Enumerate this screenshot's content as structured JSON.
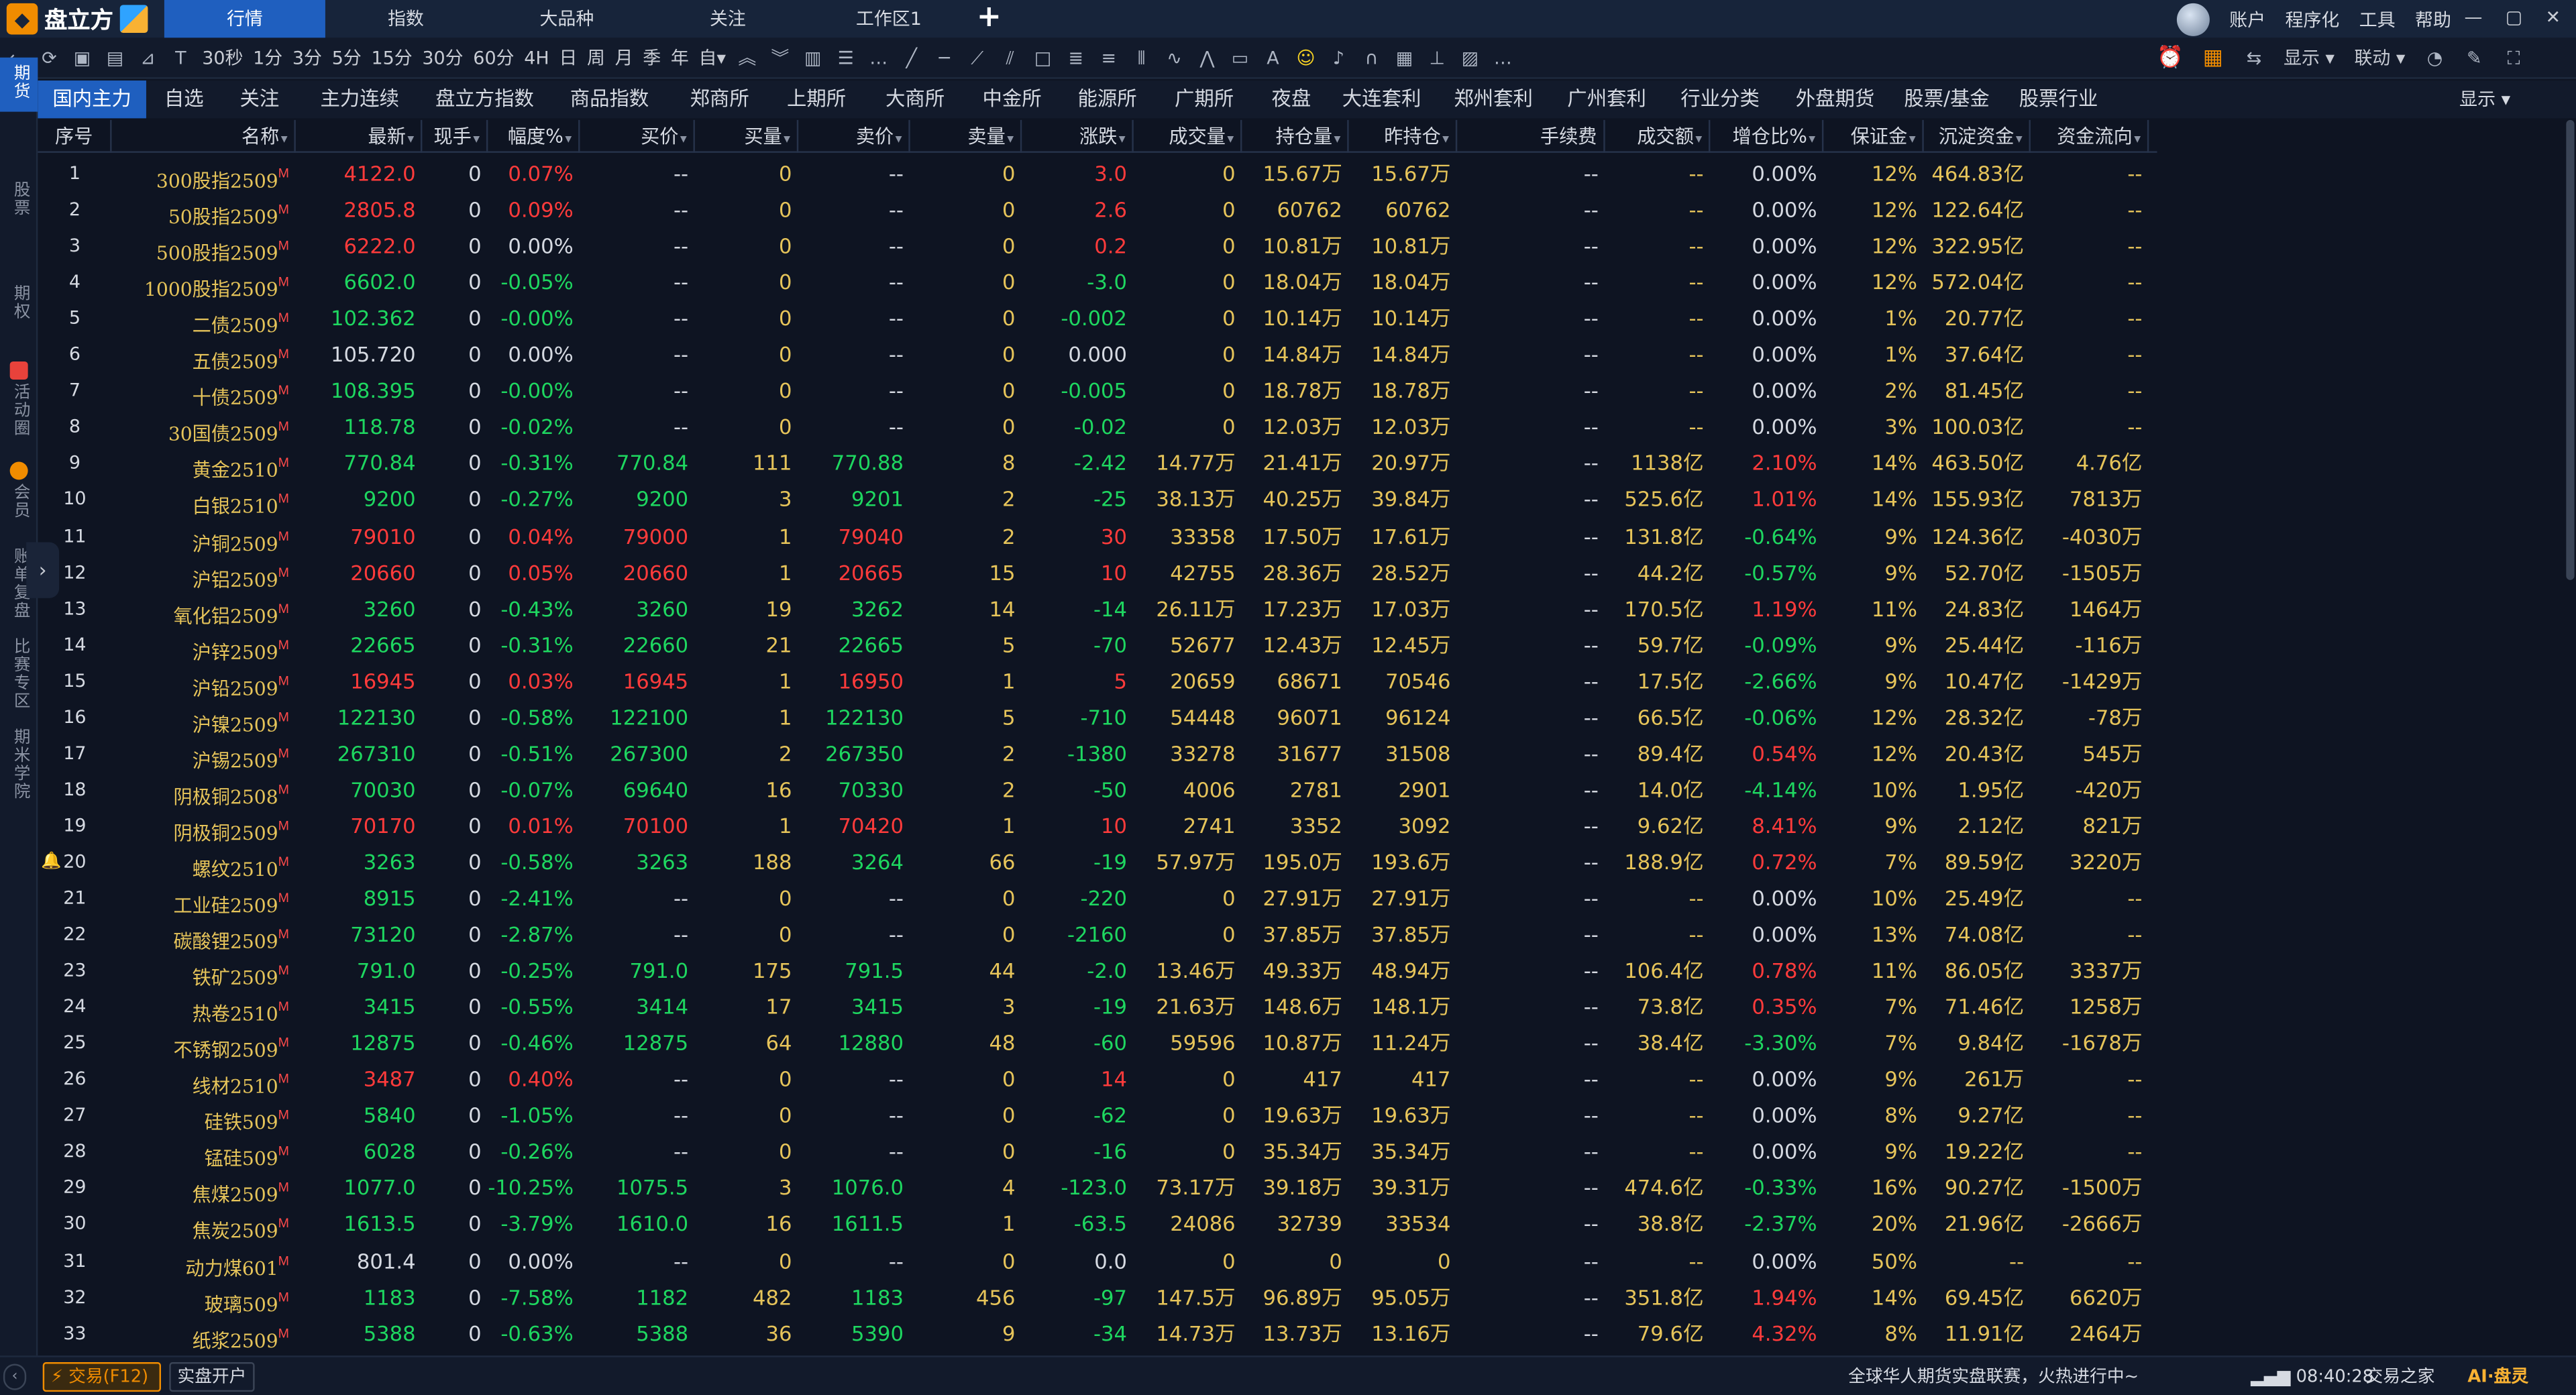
{
  "app": {
    "brand": "盘立方",
    "window_tabs": [
      "行情",
      "指数",
      "大品种",
      "关注",
      "工作区1"
    ],
    "menu": [
      "账户",
      "程序化",
      "工具",
      "帮助"
    ]
  },
  "toolbar": {
    "periods": [
      "30秒",
      "1分",
      "3分",
      "5分",
      "15分",
      "30分",
      "60分",
      "4H",
      "日",
      "周",
      "月",
      "季",
      "年",
      "自▾"
    ],
    "right": [
      "显示 ▾",
      "联动 ▾"
    ]
  },
  "left_nav": [
    "期货",
    "股票",
    "期权",
    "活动圈",
    "会员",
    "账单复盘",
    "比赛专区",
    "期米学院"
  ],
  "categories": [
    "国内主力",
    "自选",
    "关注",
    "主力连续",
    "盘立方指数",
    "商品指数",
    "郑商所",
    "上期所",
    "大商所",
    "中金所",
    "能源所",
    "广期所",
    "夜盘",
    "大连套利",
    "郑州套利",
    "广州套利",
    "行业分类",
    "外盘期货",
    "股票/基金",
    "股票行业"
  ],
  "category_show": "显示 ▾",
  "headers": [
    "序号",
    "名称",
    "最新",
    "现手",
    "幅度%",
    "买价",
    "买量",
    "卖价",
    "卖量",
    "涨跌",
    "成交量",
    "持仓量",
    "昨持仓",
    "手续费",
    "成交额",
    "增仓比%",
    "保证金",
    "沉淀资金",
    "资金流向"
  ],
  "rows": [
    [
      "1",
      "300股指2509",
      "4122.0",
      "0",
      "0.07%",
      "--",
      "0",
      "--",
      "0",
      "3.0",
      "0",
      "15.67万",
      "15.67万",
      "--",
      "--",
      "0.00%",
      "12%",
      "464.83亿",
      "--"
    ],
    [
      "2",
      "50股指2509",
      "2805.8",
      "0",
      "0.09%",
      "--",
      "0",
      "--",
      "0",
      "2.6",
      "0",
      "60762",
      "60762",
      "--",
      "--",
      "0.00%",
      "12%",
      "122.64亿",
      "--"
    ],
    [
      "3",
      "500股指2509",
      "6222.0",
      "0",
      "0.00%",
      "--",
      "0",
      "--",
      "0",
      "0.2",
      "0",
      "10.81万",
      "10.81万",
      "--",
      "--",
      "0.00%",
      "12%",
      "322.95亿",
      "--"
    ],
    [
      "4",
      "1000股指2509",
      "6602.0",
      "0",
      "-0.05%",
      "--",
      "0",
      "--",
      "0",
      "-3.0",
      "0",
      "18.04万",
      "18.04万",
      "--",
      "--",
      "0.00%",
      "12%",
      "572.04亿",
      "--"
    ],
    [
      "5",
      "二债2509",
      "102.362",
      "0",
      "-0.00%",
      "--",
      "0",
      "--",
      "0",
      "-0.002",
      "0",
      "10.14万",
      "10.14万",
      "--",
      "--",
      "0.00%",
      "1%",
      "20.77亿",
      "--"
    ],
    [
      "6",
      "五债2509",
      "105.720",
      "0",
      "0.00%",
      "--",
      "0",
      "--",
      "0",
      "0.000",
      "0",
      "14.84万",
      "14.84万",
      "--",
      "--",
      "0.00%",
      "1%",
      "37.64亿",
      "--"
    ],
    [
      "7",
      "十债2509",
      "108.395",
      "0",
      "-0.00%",
      "--",
      "0",
      "--",
      "0",
      "-0.005",
      "0",
      "18.78万",
      "18.78万",
      "--",
      "--",
      "0.00%",
      "2%",
      "81.45亿",
      "--"
    ],
    [
      "8",
      "30国债2509",
      "118.78",
      "0",
      "-0.02%",
      "--",
      "0",
      "--",
      "0",
      "-0.02",
      "0",
      "12.03万",
      "12.03万",
      "--",
      "--",
      "0.00%",
      "3%",
      "100.03亿",
      "--"
    ],
    [
      "9",
      "黄金2510",
      "770.84",
      "0",
      "-0.31%",
      "770.84",
      "111",
      "770.88",
      "8",
      "-2.42",
      "14.77万",
      "21.41万",
      "20.97万",
      "--",
      "1138亿",
      "2.10%",
      "14%",
      "463.50亿",
      "4.76亿"
    ],
    [
      "10",
      "白银2510",
      "9200",
      "0",
      "-0.27%",
      "9200",
      "3",
      "9201",
      "2",
      "-25",
      "38.13万",
      "40.25万",
      "39.84万",
      "--",
      "525.6亿",
      "1.01%",
      "14%",
      "155.93亿",
      "7813万"
    ],
    [
      "11",
      "沪铜2509",
      "79010",
      "0",
      "0.04%",
      "79000",
      "1",
      "79040",
      "2",
      "30",
      "33358",
      "17.50万",
      "17.61万",
      "--",
      "131.8亿",
      "-0.64%",
      "9%",
      "124.36亿",
      "-4030万"
    ],
    [
      "12",
      "沪铝2509",
      "20660",
      "0",
      "0.05%",
      "20660",
      "1",
      "20665",
      "15",
      "10",
      "42755",
      "28.36万",
      "28.52万",
      "--",
      "44.2亿",
      "-0.57%",
      "9%",
      "52.70亿",
      "-1505万"
    ],
    [
      "13",
      "氧化铝2509",
      "3260",
      "0",
      "-0.43%",
      "3260",
      "19",
      "3262",
      "14",
      "-14",
      "26.11万",
      "17.23万",
      "17.03万",
      "--",
      "170.5亿",
      "1.19%",
      "11%",
      "24.83亿",
      "1464万"
    ],
    [
      "14",
      "沪锌2509",
      "22665",
      "0",
      "-0.31%",
      "22660",
      "21",
      "22665",
      "5",
      "-70",
      "52677",
      "12.43万",
      "12.45万",
      "--",
      "59.7亿",
      "-0.09%",
      "9%",
      "25.44亿",
      "-116万"
    ],
    [
      "15",
      "沪铅2509",
      "16945",
      "0",
      "0.03%",
      "16945",
      "1",
      "16950",
      "1",
      "5",
      "20659",
      "68671",
      "70546",
      "--",
      "17.5亿",
      "-2.66%",
      "9%",
      "10.47亿",
      "-1429万"
    ],
    [
      "16",
      "沪镍2509",
      "122130",
      "0",
      "-0.58%",
      "122100",
      "1",
      "122130",
      "5",
      "-710",
      "54448",
      "96071",
      "96124",
      "--",
      "66.5亿",
      "-0.06%",
      "12%",
      "28.32亿",
      "-78万"
    ],
    [
      "17",
      "沪锡2509",
      "267310",
      "0",
      "-0.51%",
      "267300",
      "2",
      "267350",
      "2",
      "-1380",
      "33278",
      "31677",
      "31508",
      "--",
      "89.4亿",
      "0.54%",
      "12%",
      "20.43亿",
      "545万"
    ],
    [
      "18",
      "阴极铜2508",
      "70030",
      "0",
      "-0.07%",
      "69640",
      "16",
      "70330",
      "2",
      "-50",
      "4006",
      "2781",
      "2901",
      "--",
      "14.0亿",
      "-4.14%",
      "10%",
      "1.95亿",
      "-420万"
    ],
    [
      "19",
      "阴极铜2509",
      "70170",
      "0",
      "0.01%",
      "70100",
      "1",
      "70420",
      "1",
      "10",
      "2741",
      "3352",
      "3092",
      "--",
      "9.62亿",
      "8.41%",
      "9%",
      "2.12亿",
      "821万"
    ],
    [
      "20",
      "螺纹2510",
      "3263",
      "0",
      "-0.58%",
      "3263",
      "188",
      "3264",
      "66",
      "-19",
      "57.97万",
      "195.0万",
      "193.6万",
      "--",
      "188.9亿",
      "0.72%",
      "7%",
      "89.59亿",
      "3220万"
    ],
    [
      "21",
      "工业硅2509",
      "8915",
      "0",
      "-2.41%",
      "--",
      "0",
      "--",
      "0",
      "-220",
      "0",
      "27.91万",
      "27.91万",
      "--",
      "--",
      "0.00%",
      "10%",
      "25.49亿",
      "--"
    ],
    [
      "22",
      "碳酸锂2509",
      "73120",
      "0",
      "-2.87%",
      "--",
      "0",
      "--",
      "0",
      "-2160",
      "0",
      "37.85万",
      "37.85万",
      "--",
      "--",
      "0.00%",
      "13%",
      "74.08亿",
      "--"
    ],
    [
      "23",
      "铁矿2509",
      "791.0",
      "0",
      "-0.25%",
      "791.0",
      "175",
      "791.5",
      "44",
      "-2.0",
      "13.46万",
      "49.33万",
      "48.94万",
      "--",
      "106.4亿",
      "0.78%",
      "11%",
      "86.05亿",
      "3337万"
    ],
    [
      "24",
      "热卷2510",
      "3415",
      "0",
      "-0.55%",
      "3414",
      "17",
      "3415",
      "3",
      "-19",
      "21.63万",
      "148.6万",
      "148.1万",
      "--",
      "73.8亿",
      "0.35%",
      "7%",
      "71.46亿",
      "1258万"
    ],
    [
      "25",
      "不锈钢2509",
      "12875",
      "0",
      "-0.46%",
      "12875",
      "64",
      "12880",
      "48",
      "-60",
      "59596",
      "10.87万",
      "11.24万",
      "--",
      "38.4亿",
      "-3.30%",
      "7%",
      "9.84亿",
      "-1678万"
    ],
    [
      "26",
      "线材2510",
      "3487",
      "0",
      "0.40%",
      "--",
      "0",
      "--",
      "0",
      "14",
      "0",
      "417",
      "417",
      "--",
      "--",
      "0.00%",
      "9%",
      "261万",
      "--"
    ],
    [
      "27",
      "硅铁509",
      "5840",
      "0",
      "-1.05%",
      "--",
      "0",
      "--",
      "0",
      "-62",
      "0",
      "19.63万",
      "19.63万",
      "--",
      "--",
      "0.00%",
      "8%",
      "9.27亿",
      "--"
    ],
    [
      "28",
      "锰硅509",
      "6028",
      "0",
      "-0.26%",
      "--",
      "0",
      "--",
      "0",
      "-16",
      "0",
      "35.34万",
      "35.34万",
      "--",
      "--",
      "0.00%",
      "9%",
      "19.22亿",
      "--"
    ],
    [
      "29",
      "焦煤2509",
      "1077.0",
      "0",
      "-10.25%",
      "1075.5",
      "3",
      "1076.0",
      "4",
      "-123.0",
      "73.17万",
      "39.18万",
      "39.31万",
      "--",
      "474.6亿",
      "-0.33%",
      "16%",
      "90.27亿",
      "-1500万"
    ],
    [
      "30",
      "焦炭2509",
      "1613.5",
      "0",
      "-3.79%",
      "1610.0",
      "16",
      "1611.5",
      "1",
      "-63.5",
      "24086",
      "32739",
      "33534",
      "--",
      "38.8亿",
      "-2.37%",
      "20%",
      "21.96亿",
      "-2666万"
    ],
    [
      "31",
      "动力煤601",
      "801.4",
      "0",
      "0.00%",
      "--",
      "0",
      "--",
      "0",
      "0.0",
      "0",
      "0",
      "0",
      "--",
      "--",
      "0.00%",
      "50%",
      "--",
      "--"
    ],
    [
      "32",
      "玻璃509",
      "1183",
      "0",
      "-7.58%",
      "1182",
      "482",
      "1183",
      "456",
      "-97",
      "147.5万",
      "96.89万",
      "95.05万",
      "--",
      "351.8亿",
      "1.94%",
      "14%",
      "69.45亿",
      "6620万"
    ],
    [
      "33",
      "纸浆2509",
      "5388",
      "0",
      "-0.63%",
      "5388",
      "36",
      "5390",
      "9",
      "-34",
      "14.73万",
      "13.73万",
      "13.16万",
      "--",
      "79.6亿",
      "4.32%",
      "8%",
      "11.91亿",
      "2464万"
    ]
  ],
  "status": {
    "trade": "交易(F12)",
    "open_account": "实盘开户",
    "news": "全球华人期货实盘联赛，火热进行中~",
    "time": "08:40:28",
    "home": "交易之家",
    "ai": "AI·盘灵"
  },
  "colors": {
    "up": "#ff3b3b",
    "down": "#1ed760",
    "name": "#e6c45a",
    "active_tab": "#1f5fbf"
  }
}
